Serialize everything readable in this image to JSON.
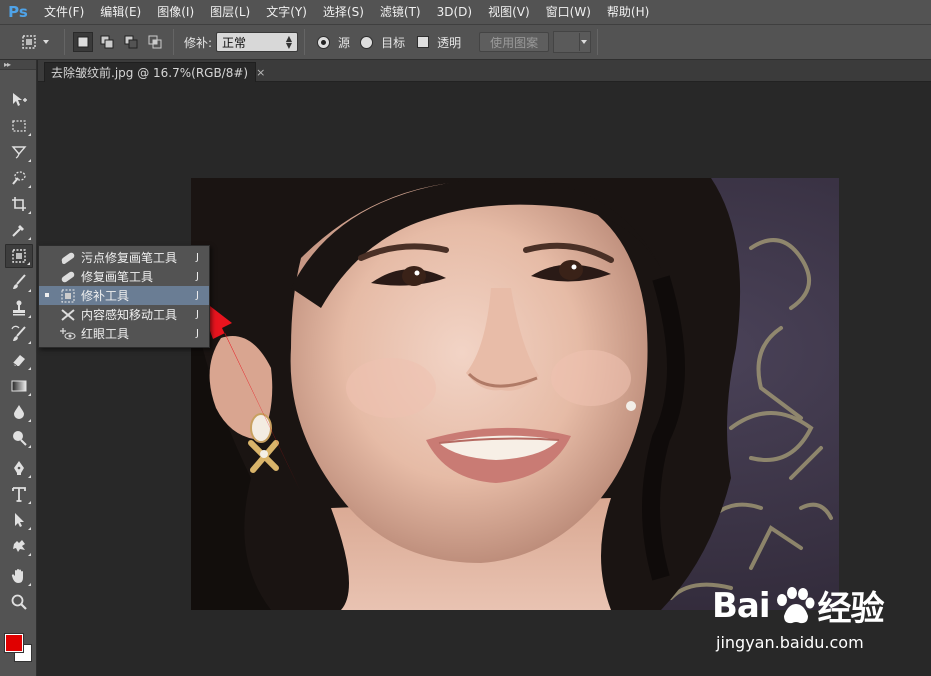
{
  "app": {
    "logo": "Ps",
    "menu": [
      "文件(F)",
      "编辑(E)",
      "图像(I)",
      "图层(L)",
      "文字(Y)",
      "选择(S)",
      "滤镜(T)",
      "3D(D)",
      "视图(V)",
      "窗口(W)",
      "帮助(H)"
    ]
  },
  "options": {
    "patch_label": "修补:",
    "patch_mode": "正常",
    "source_label": "源",
    "target_label": "目标",
    "transparent_label": "透明",
    "use_pattern_label": "使用图案"
  },
  "document": {
    "tab_title": "去除皱纹前.jpg @ 16.7%(RGB/8#)",
    "close_glyph": "×"
  },
  "flyout": {
    "items": [
      {
        "label": "污点修复画笔工具",
        "key": "J",
        "icon": "spot-healing-brush-icon"
      },
      {
        "label": "修复画笔工具",
        "key": "J",
        "icon": "healing-brush-icon"
      },
      {
        "label": "修补工具",
        "key": "J",
        "icon": "patch-icon"
      },
      {
        "label": "内容感知移动工具",
        "key": "J",
        "icon": "content-aware-move-icon"
      },
      {
        "label": "红眼工具",
        "key": "J",
        "icon": "red-eye-icon"
      }
    ],
    "selected_index": 2
  },
  "colors": {
    "foreground": "#e00000",
    "background": "#ffffff",
    "accent_arrow": "#e8141e"
  },
  "watermark": {
    "brand_left": "Bai",
    "brand_right": "经验",
    "url": "jingyan.baidu.com"
  }
}
